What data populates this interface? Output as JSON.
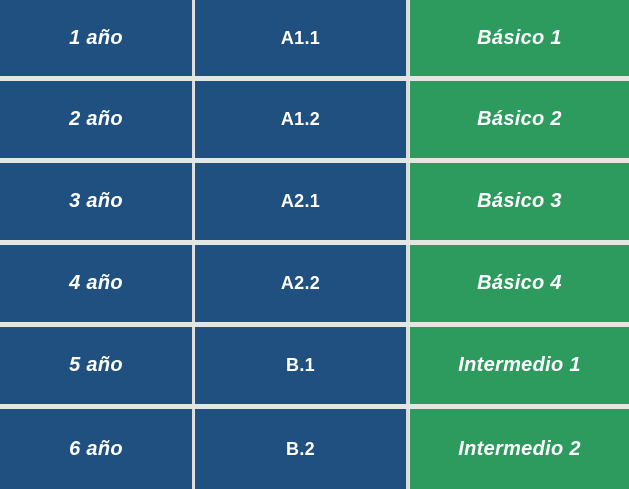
{
  "rows": [
    {
      "year": "1 año",
      "code": "A1.1",
      "level": "Básico 1"
    },
    {
      "year": "2 año",
      "code": "A1.2",
      "level": "Básico 2"
    },
    {
      "year": "3 año",
      "code": "A2.1",
      "level": "Básico 3"
    },
    {
      "year": "4 año",
      "code": "A2.2",
      "level": "Básico 4"
    },
    {
      "year": "5 año",
      "code": "B.1",
      "level": "Intermedio 1"
    },
    {
      "year": "6 año",
      "code": "B.2",
      "level": "Intermedio 2"
    }
  ],
  "colors": {
    "blue": "#20507f",
    "green": "#2c9b5d",
    "divider": "#e4e6e3"
  }
}
